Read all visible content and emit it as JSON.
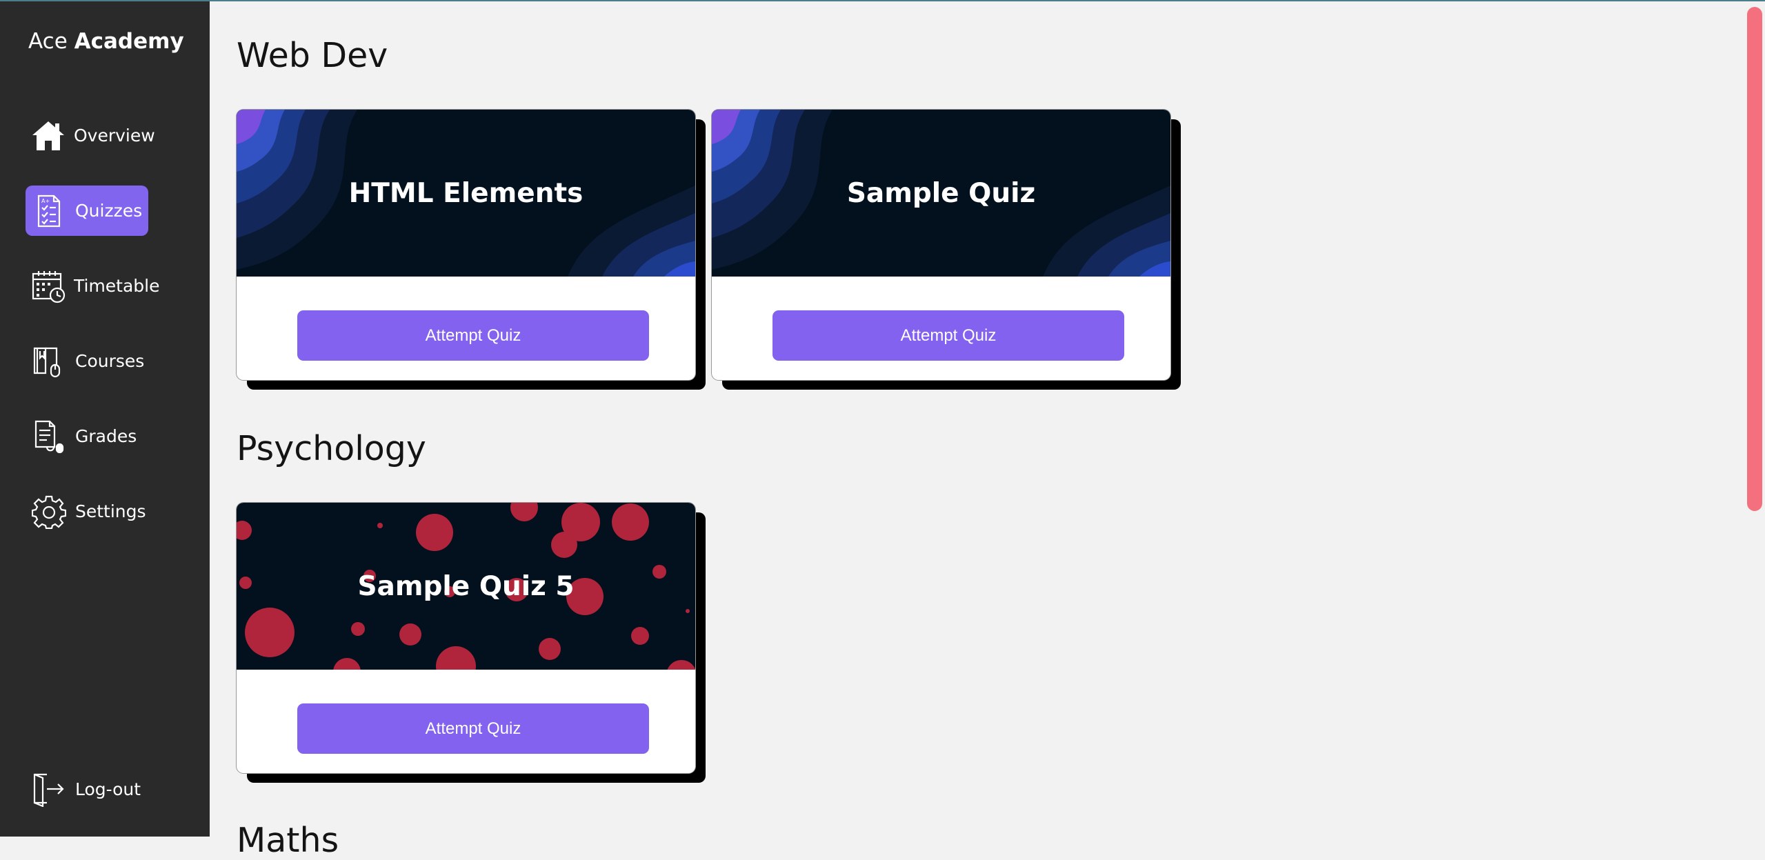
{
  "brand": {
    "light": "Ace ",
    "bold": "Academy"
  },
  "sidebar": {
    "items": [
      {
        "label": "Overview",
        "icon": "home-icon"
      },
      {
        "label": "Quizzes",
        "icon": "quiz-icon",
        "active": true
      },
      {
        "label": "Timetable",
        "icon": "calendar-icon"
      },
      {
        "label": "Courses",
        "icon": "book-icon"
      },
      {
        "label": "Grades",
        "icon": "grades-icon"
      },
      {
        "label": "Settings",
        "icon": "gear-icon"
      }
    ],
    "logout": {
      "label": "Log-out",
      "icon": "logout-icon"
    }
  },
  "sections": [
    {
      "title": "Web Dev",
      "quizzes": [
        {
          "title": "HTML Elements",
          "button": "Attempt Quiz"
        },
        {
          "title": "Sample Quiz",
          "button": "Attempt Quiz"
        }
      ]
    },
    {
      "title": "Psychology",
      "quizzes": [
        {
          "title": "Sample Quiz 5",
          "button": "Attempt Quiz"
        }
      ]
    },
    {
      "title": "Maths"
    }
  ],
  "colors": {
    "accent": "#8265ee",
    "sidebar": "#2a2a2a",
    "banner": "#03101e",
    "dots": "#b0243c",
    "scrollbar": "#f5707e"
  }
}
